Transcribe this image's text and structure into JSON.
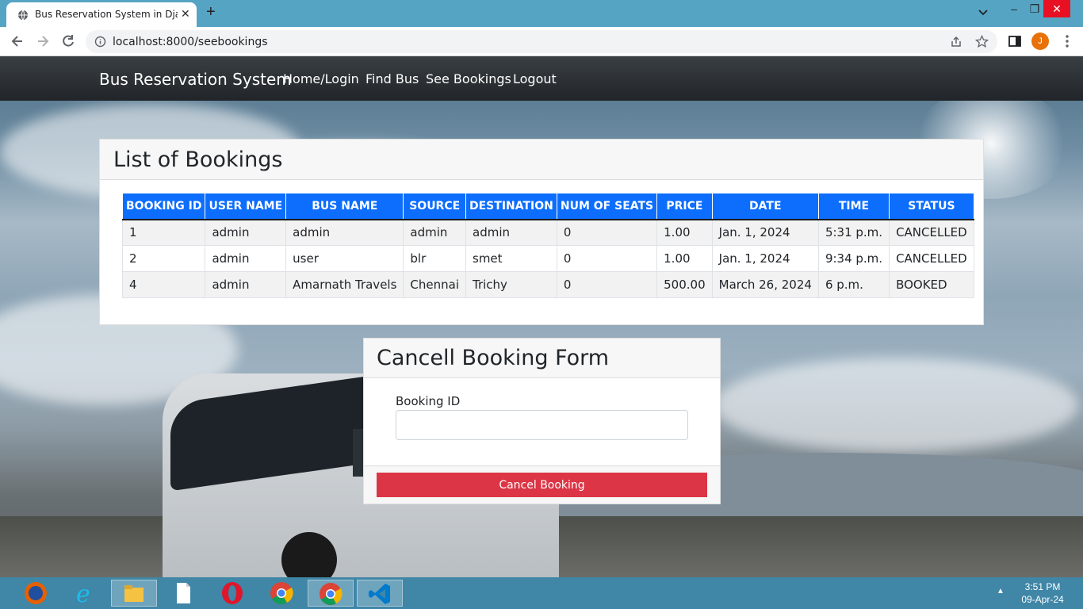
{
  "browser": {
    "tab_title": "Bus Reservation System in Djang",
    "url": "localhost:8000/seebookings",
    "profile_initial": "J",
    "new_tab_symbol": "+",
    "tab_close_symbol": "✕"
  },
  "navbar": {
    "brand": "Bus Reservation System",
    "links": [
      "Home/Login",
      "Find Bus",
      "See Bookings",
      "Logout"
    ]
  },
  "bookings": {
    "title": "List of Bookings",
    "columns": [
      "BOOKING ID",
      "USER NAME",
      "BUS NAME",
      "SOURCE",
      "DESTINATION",
      "NUM OF SEATS",
      "PRICE",
      "DATE",
      "TIME",
      "STATUS"
    ],
    "rows": [
      [
        "1",
        "admin",
        "admin",
        "admin",
        "admin",
        "0",
        "1.00",
        "Jan. 1, 2024",
        "5:31 p.m.",
        "CANCELLED"
      ],
      [
        "2",
        "admin",
        "user",
        "blr",
        "smet",
        "0",
        "1.00",
        "Jan. 1, 2024",
        "9:34 p.m.",
        "CANCELLED"
      ],
      [
        "4",
        "admin",
        "Amarnath Travels",
        "Chennai",
        "Trichy",
        "0",
        "500.00",
        "March 26, 2024",
        "6 p.m.",
        "BOOKED"
      ]
    ]
  },
  "cancel_form": {
    "title": "Cancell Booking Form",
    "field_label": "Booking ID",
    "field_value": "",
    "button_label": "Cancel Booking"
  },
  "taskbar": {
    "time": "3:51 PM",
    "date": "09-Apr-24",
    "apps": [
      "firefox-icon",
      "internet-explorer-icon",
      "file-explorer-icon",
      "notepad-icon",
      "opera-icon",
      "chrome-icon",
      "chrome-active-icon",
      "vscode-icon"
    ]
  },
  "colors": {
    "header_blue": "#0d6efd",
    "danger_red": "#dc3545",
    "navbar_dark": "#212529"
  }
}
